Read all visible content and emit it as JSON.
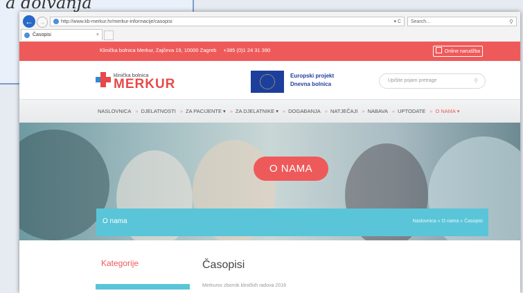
{
  "slide": {
    "title_fragment": "a dolvanja"
  },
  "browser": {
    "url": "http://www.kb-merkur.hr/merkur-informacije/casopisi",
    "url_actions": "▾ C",
    "search_placeholder": "Search...",
    "tab_label": "Časopisi",
    "tab_close": "×"
  },
  "topbar": {
    "address": "Klinička bolnica Merkur, Zajčeva 19, 10000 Zagreb",
    "phone": "+385 (0)1 24 31 390",
    "online_label": "Online narudžba",
    "color": "#ee5a5a"
  },
  "header": {
    "logo_small": "klinička bolnica",
    "logo_big": "MERKUR",
    "eu_line1": "Europski projekt",
    "eu_line2": "Dnevna bolnica",
    "search_placeholder": "Upišite pojam pretrage"
  },
  "nav": {
    "items": [
      {
        "label": "NASLOVNICA"
      },
      {
        "label": "DJELATNOSTI"
      },
      {
        "label": "ZA PACIJENTE ▾"
      },
      {
        "label": "ZA DJELATNIKE ▾"
      },
      {
        "label": "DOGAĐANJA"
      },
      {
        "label": "NATJEČAJI"
      },
      {
        "label": "NABAVA"
      },
      {
        "label": "UPTODATE"
      },
      {
        "label": "O NAMA ▾"
      }
    ],
    "active_index": 8
  },
  "hero": {
    "pill_label": "O NAMA",
    "breadcrumb_title": "O nama",
    "breadcrumb_path": "Naslovnica » O nama » Časopisi",
    "accent": "#5ac5d8"
  },
  "content": {
    "sidebar_title": "Kategorije",
    "page_title": "Časopisi",
    "first_line": "Merkurov zbornik kliničkih radova 2016"
  }
}
